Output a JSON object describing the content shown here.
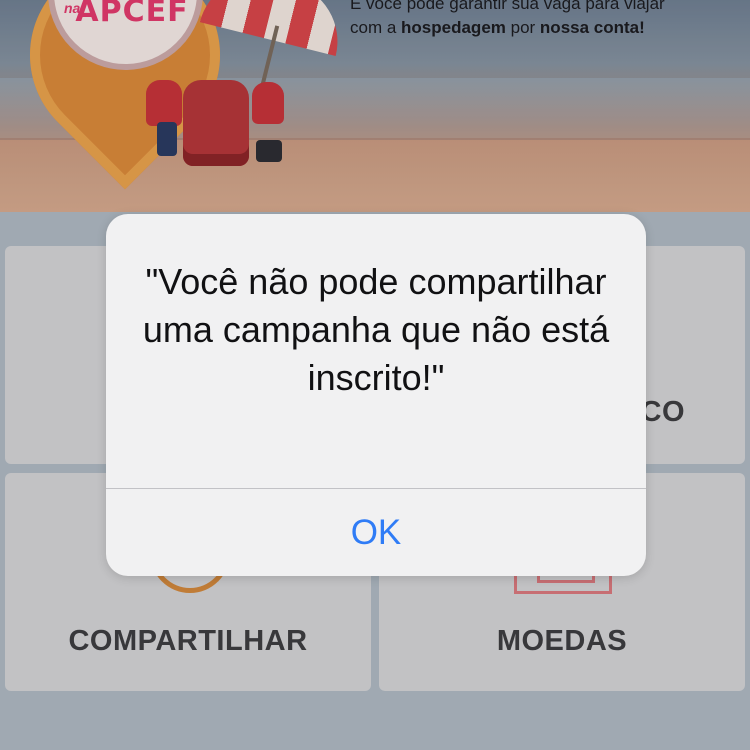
{
  "banner": {
    "logo_prefix": "na",
    "logo_text": "APCEF",
    "line1": "E você pode garantir sua vaga para viajar",
    "line2_parts": [
      "com a ",
      "hospedagem",
      " por ",
      "nossa conta!"
    ]
  },
  "tiles": [
    {
      "label": ""
    },
    {
      "label": "CO"
    },
    {
      "label": "COMPARTILHAR"
    },
    {
      "label": "MOEDAS"
    }
  ],
  "alert": {
    "message": "\"Você não pode compartilhar uma campanha que não está inscrito!\"",
    "ok_label": "OK"
  },
  "colors": {
    "ios_blue": "#2f7cf6",
    "logo_pink": "#e23a6d",
    "tile_bg": "#d3d3d5"
  }
}
